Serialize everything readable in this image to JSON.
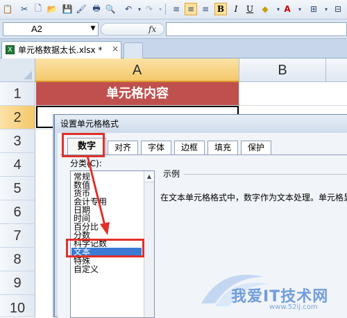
{
  "formula_bar": {
    "name_box": "A2",
    "fx": "fx",
    "value": ""
  },
  "workbook_tab": {
    "title": "单元格数据太长.xlsx *",
    "close": "×"
  },
  "columns": [
    "A",
    "B"
  ],
  "rows": [
    "1",
    "2",
    "3",
    "4",
    "5",
    "6",
    "7",
    "8",
    "9",
    "10"
  ],
  "cells": {
    "A1": "单元格内容"
  },
  "dialog": {
    "title": "设置单元格格式",
    "tabs": [
      "数字",
      "对齐",
      "字体",
      "边框",
      "填充",
      "保护"
    ],
    "active_tab": "数字",
    "category_label": "分类(C):",
    "categories": [
      "常规",
      "数值",
      "货币",
      "会计专用",
      "日期",
      "时间",
      "百分比",
      "分数",
      "科学记数",
      "文本",
      "特殊",
      "自定义"
    ],
    "selected_category": "文本",
    "sample_label": "示例",
    "description": "在文本单元格格式中，数字作为文本处理。单元格显"
  },
  "watermark": {
    "text": "我爱IT技术网",
    "url": "www.52ij.com"
  },
  "colors": {
    "header_fill": "#c0504d",
    "selection": "#3b7bd5",
    "annotation": "#e0302a"
  }
}
